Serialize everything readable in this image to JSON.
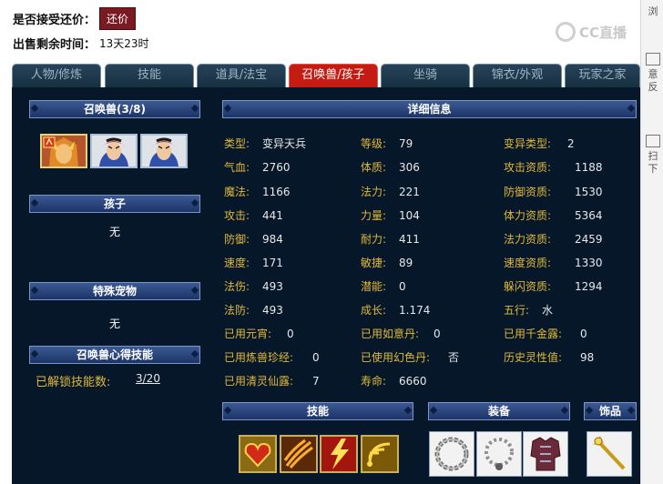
{
  "header": {
    "accept_counter_label": "是否接受还价：",
    "counter_button": "还价",
    "remaining_label": "出售剩余时间：",
    "remaining_value": "13天23时"
  },
  "watermark": {
    "text": "CC直播"
  },
  "side_panel": {
    "items": [
      "浏",
      "意",
      "反",
      "扫",
      "下"
    ]
  },
  "tabs": [
    {
      "label": "人物/修炼",
      "active": false
    },
    {
      "label": "技能",
      "active": false
    },
    {
      "label": "道具/法宝",
      "active": false
    },
    {
      "label": "召唤兽/孩子",
      "active": true
    },
    {
      "label": "坐骑",
      "active": false
    },
    {
      "label": "锦衣/外观",
      "active": false
    },
    {
      "label": "玩家之家",
      "active": false
    }
  ],
  "left": {
    "pets_header": "召唤兽(3/8)",
    "pets": [
      {
        "icon": "fire-mask-pet-icon",
        "selected": true
      },
      {
        "icon": "warrior-pet-icon",
        "selected": false
      },
      {
        "icon": "warrior-pet-icon",
        "selected": false
      }
    ],
    "child_header": "孩子",
    "child_value": "无",
    "special_header": "特殊宠物",
    "special_value": "无",
    "skills_header": "召唤兽心得技能",
    "unlocked_label": "已解锁技能数:",
    "unlocked_value": "3/20"
  },
  "details": {
    "header": "详细信息",
    "stats": [
      [
        {
          "label": "类型:",
          "value": "变异天兵"
        },
        {
          "label": "气血:",
          "value": "2760"
        },
        {
          "label": "魔法:",
          "value": "1166"
        },
        {
          "label": "攻击:",
          "value": "441"
        },
        {
          "label": "防御:",
          "value": "984"
        },
        {
          "label": "速度:",
          "value": "171"
        },
        {
          "label": "法伤:",
          "value": "493"
        },
        {
          "label": "法防:",
          "value": "493"
        },
        {
          "label": "已用元宵:",
          "value": "0"
        },
        {
          "label": "已用炼兽珍经:",
          "value": "0"
        },
        {
          "label": "已用清灵仙露:",
          "value": "7"
        }
      ],
      [
        {
          "label": "等级:",
          "value": "79"
        },
        {
          "label": "体质:",
          "value": "306"
        },
        {
          "label": "法力:",
          "value": "221"
        },
        {
          "label": "力量:",
          "value": "104"
        },
        {
          "label": "耐力:",
          "value": "411"
        },
        {
          "label": "敏捷:",
          "value": "89"
        },
        {
          "label": "潜能:",
          "value": "0"
        },
        {
          "label": "成长:",
          "value": "1.174"
        },
        {
          "label": "已用如意丹:",
          "value": "0"
        },
        {
          "label": "已使用幻色丹:",
          "value": "否"
        },
        {
          "label": "寿命:",
          "value": "6660"
        }
      ],
      [
        {
          "label": "变异类型:",
          "value": "2"
        },
        {
          "label": "攻击资质:",
          "value": "1188"
        },
        {
          "label": "防御资质:",
          "value": "1530"
        },
        {
          "label": "体力资质:",
          "value": "5364"
        },
        {
          "label": "法力资质:",
          "value": "2459"
        },
        {
          "label": "速度资质:",
          "value": "1330"
        },
        {
          "label": "躲闪资质:",
          "value": "1294"
        },
        {
          "label": "五行:",
          "value": "水"
        },
        {
          "label": "已用千金露:",
          "value": "0"
        },
        {
          "label": "历史灵性值:",
          "value": "98"
        }
      ]
    ]
  },
  "bottom": {
    "skills_header": "技能",
    "equipment_header": "装备",
    "accessory_header": "饰品",
    "skill_icons": [
      "heart-shield-skill-icon",
      "claw-strike-skill-icon",
      "lightning-bolt-skill-icon",
      "sonic-wave-skill-icon"
    ],
    "equipment_icons": [
      "chain-collar-icon",
      "bead-necklace-icon",
      "armor-icon"
    ],
    "accessory_icon": "golden-staff-icon"
  },
  "colors": {
    "panel_bg": "#06172a",
    "label_gold": "#e0b838",
    "value_white": "#e8e8e8",
    "active_tab": "#c41c12",
    "counter_button": "#7a1a22"
  }
}
